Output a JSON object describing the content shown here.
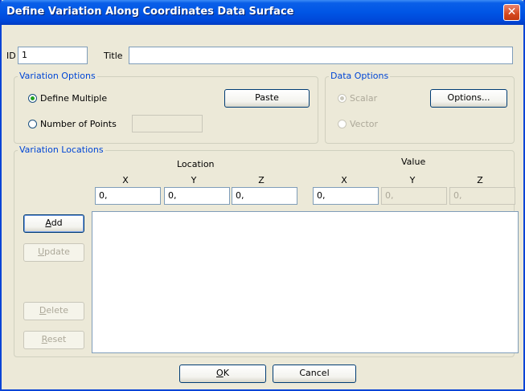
{
  "window": {
    "title": "Define Variation Along Coordinates Data Surface",
    "close_glyph": "✕"
  },
  "header": {
    "id_label": "ID",
    "id_value": "1",
    "title_label": "Title",
    "title_value": ""
  },
  "variation_options": {
    "group_label": "Variation Options",
    "define_multiple_label": "Define Multiple",
    "define_multiple_selected": true,
    "number_of_points_label": "Number of Points",
    "number_of_points_value": "",
    "paste_label": "Paste"
  },
  "data_options": {
    "group_label": "Data Options",
    "scalar_label": "Scalar",
    "scalar_selected": true,
    "vector_label": "Vector",
    "options_label": "Options..."
  },
  "variation_locations": {
    "group_label": "Variation Locations",
    "location_header": "Location",
    "value_header": "Value",
    "axes": [
      "X",
      "Y",
      "Z"
    ],
    "location_values": [
      "0,",
      "0,",
      "0,"
    ],
    "value_values": [
      "0,",
      "0,",
      "0,"
    ],
    "add_label": "Add",
    "add_mnemonic": "A",
    "add_rest": "dd",
    "update_mnemonic": "U",
    "update_rest": "pdate",
    "delete_mnemonic": "D",
    "delete_rest": "elete",
    "reset_mnemonic": "R",
    "reset_rest": "eset"
  },
  "footer": {
    "ok_mnemonic": "O",
    "ok_rest": "K",
    "cancel_label": "Cancel"
  }
}
